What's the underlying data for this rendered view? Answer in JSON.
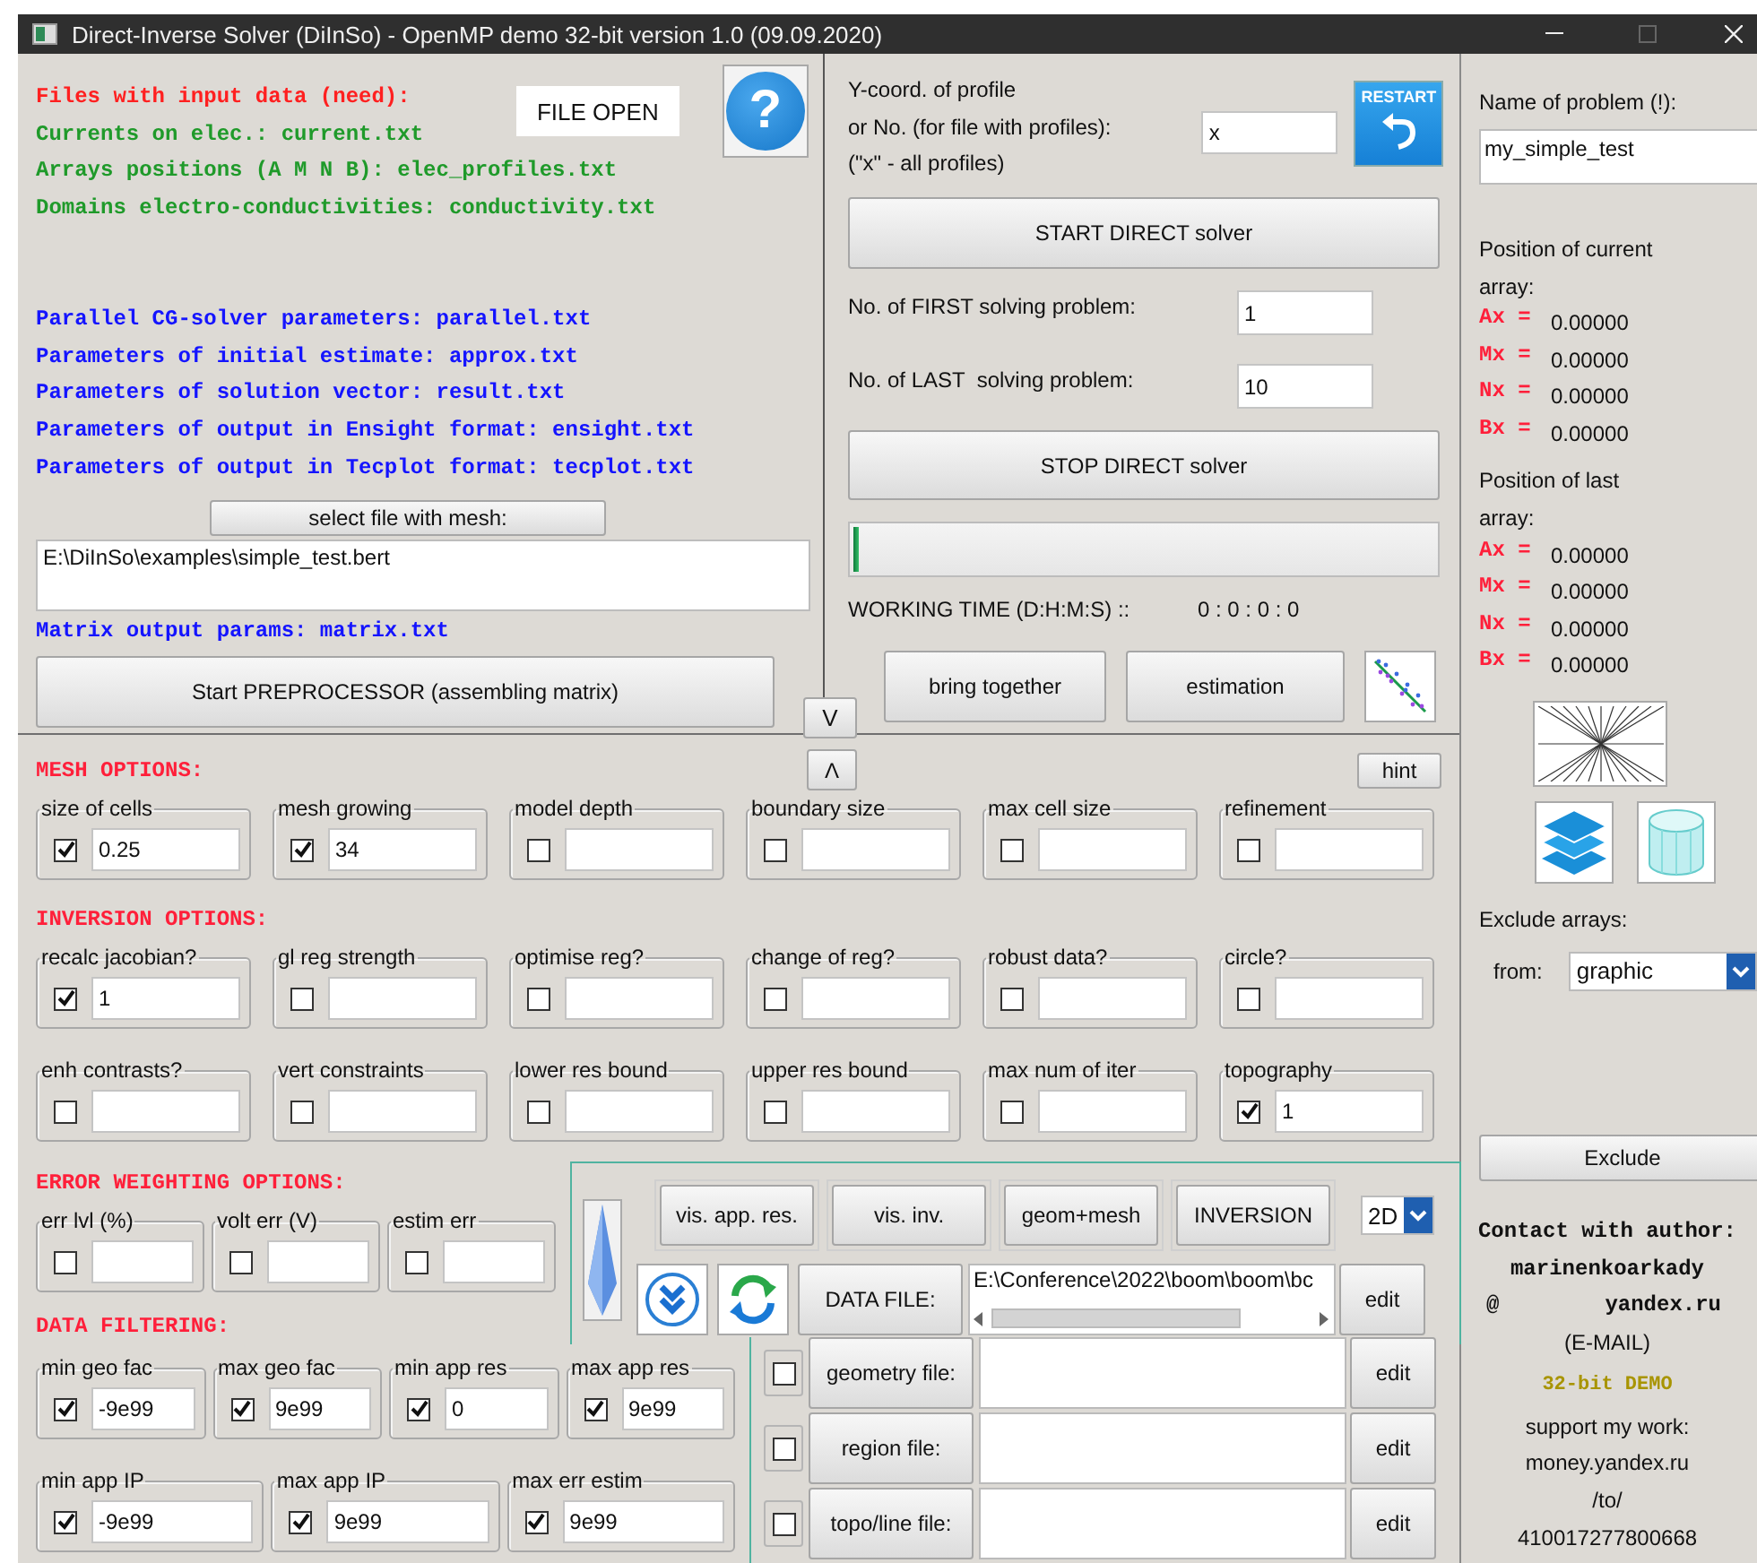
{
  "window": {
    "title": "Direct-Inverse Solver (DiInSo) - OpenMP demo 32-bit version 1.0 (09.09.2020)"
  },
  "input_files": {
    "heading": "Files with input data (need):",
    "lines": [
      {
        "text": "Currents on elec.: current.txt",
        "kind": "required"
      },
      {
        "text": "Arrays positions (A M N B): elec_profiles.txt",
        "kind": "required"
      },
      {
        "text": "Domains electro-conductivities: conductivity.txt",
        "kind": "required"
      },
      {
        "text": "Parallel CG-solver parameters: parallel.txt",
        "kind": "optional"
      },
      {
        "text": "Parameters of initial estimate: approx.txt",
        "kind": "optional"
      },
      {
        "text": "Parameters of solution vector: result.txt",
        "kind": "optional"
      },
      {
        "text": "Parameters of output in Ensight format: ensight.txt",
        "kind": "optional"
      },
      {
        "text": "Parameters of output in Tecplot format: tecplot.txt",
        "kind": "optional"
      }
    ]
  },
  "file_open_button": "FILE OPEN",
  "help_button": "?",
  "mesh_file": {
    "button": "select file with mesh:",
    "path": "E:\\DiInSo\\examples\\simple_test.bert"
  },
  "matrix_line": "Matrix output params: matrix.txt",
  "preprocessor_button": "Start PREPROCESSOR (assembling matrix)",
  "collapse_button": "V",
  "profile": {
    "lines": [
      "Y-coord. of profile",
      "or No. (for file with profiles):",
      "(\"x\" - all profiles)"
    ],
    "value": "x"
  },
  "restart_button": "RESTART",
  "start_button": "START DIRECT solver",
  "first_problem": {
    "label": "No. of FIRST solving problem:",
    "value": "1"
  },
  "last_problem": {
    "label": "No. of LAST  solving problem:",
    "value": "10"
  },
  "stop_button": "STOP DIRECT solver",
  "progress": {
    "level": 0.01
  },
  "working_time": {
    "label": "WORKING TIME (D:H:M:S) ::",
    "value": "0 : 0 : 0 : 0"
  },
  "bring_together_button": "bring together",
  "estimation_button": "estimation",
  "expand_button": "Λ",
  "hint_button": "hint",
  "mesh_options": {
    "title": "MESH OPTIONS:",
    "rows": [
      [
        {
          "label": "size of cells",
          "checked": true,
          "value": "0.25"
        },
        {
          "label": "mesh growing",
          "checked": true,
          "value": "34"
        },
        {
          "label": "model depth",
          "checked": false
        },
        {
          "label": "boundary size",
          "checked": false
        },
        {
          "label": "max cell size",
          "checked": false
        },
        {
          "label": "refinement",
          "checked": false
        }
      ]
    ]
  },
  "inversion_options": {
    "title": "INVERSION OPTIONS:",
    "rows": [
      [
        {
          "label": "recalc jacobian?",
          "checked": true,
          "value": "1"
        },
        {
          "label": "gl reg strength",
          "checked": false
        },
        {
          "label": "optimise reg?",
          "checked": false
        },
        {
          "label": "change of reg?",
          "checked": false
        },
        {
          "label": "robust data?",
          "checked": false
        },
        {
          "label": "circle?",
          "checked": false
        }
      ],
      [
        {
          "label": "enh contrasts?",
          "checked": false
        },
        {
          "label": "vert constraints",
          "checked": false
        },
        {
          "label": "lower res bound",
          "checked": false
        },
        {
          "label": "upper res bound",
          "checked": false
        },
        {
          "label": "max num of iter",
          "checked": false
        },
        {
          "label": "topography",
          "checked": true,
          "value": "1"
        }
      ]
    ]
  },
  "error_weighting": {
    "title": "ERROR WEIGHTING OPTIONS:",
    "rows": [
      [
        {
          "label": "err lvl (%)",
          "checked": false
        },
        {
          "label": "volt err (V)",
          "checked": false
        },
        {
          "label": "estim err",
          "checked": false
        }
      ]
    ]
  },
  "data_filtering": {
    "title": "DATA FILTERING:",
    "rows": [
      [
        {
          "label": "min geo fac",
          "checked": true,
          "value": "-9e99"
        },
        {
          "label": "max geo fac",
          "checked": true,
          "value": "9e99"
        },
        {
          "label": "min app res",
          "checked": true,
          "value": "0"
        },
        {
          "label": "max app res",
          "checked": true,
          "value": "9e99"
        }
      ],
      [
        {
          "label": "min app IP",
          "checked": true,
          "value": "-9e99"
        },
        {
          "label": "max app IP",
          "checked": true,
          "value": "9e99"
        },
        {
          "label": "max err estim",
          "checked": true,
          "value": "9e99"
        }
      ]
    ]
  },
  "view_buttons": [
    "vis. app. res.",
    "vis. inv.",
    "geom+mesh",
    "INVERSION"
  ],
  "dimension": "2D",
  "data_file": {
    "label": "DATA FILE:",
    "path": "E:\\Conference\\2022\\boom\\boom\\bc",
    "edit": "edit"
  },
  "extra_files": [
    {
      "label": "geometry file:",
      "checked": false,
      "edit": "edit"
    },
    {
      "label": "region file:",
      "checked": false,
      "edit": "edit"
    },
    {
      "label": "topo/line file:",
      "checked": false,
      "edit": "edit"
    }
  ],
  "problem": {
    "label": "Name of problem (!):",
    "value": "my_simple_test"
  },
  "current_array": {
    "title": "Position of current array:",
    "coords": [
      {
        "name": "Ax =",
        "value": "0.00000"
      },
      {
        "name": "Mx =",
        "value": "0.00000"
      },
      {
        "name": "Nx =",
        "value": "0.00000"
      },
      {
        "name": "Bx =",
        "value": "0.00000"
      }
    ]
  },
  "last_array": {
    "title": "Position of last array:",
    "coords": [
      {
        "name": "Ax =",
        "value": "0.00000"
      },
      {
        "name": "Mx =",
        "value": "0.00000"
      },
      {
        "name": "Nx =",
        "value": "0.00000"
      },
      {
        "name": "Bx =",
        "value": "0.00000"
      }
    ]
  },
  "exclude": {
    "label": "Exclude arrays:",
    "from": "from:",
    "source": "graphic",
    "button": "Exclude"
  },
  "contact": {
    "title": "Contact with author:",
    "user": "marinenkoarkady",
    "at": "@",
    "domain": "yandex.ru",
    "note": "(E-MAIL)",
    "demo": "32-bit DEMO",
    "support": [
      "support my work:",
      "money.yandex.ru",
      "/to/",
      "410017277800668"
    ]
  }
}
